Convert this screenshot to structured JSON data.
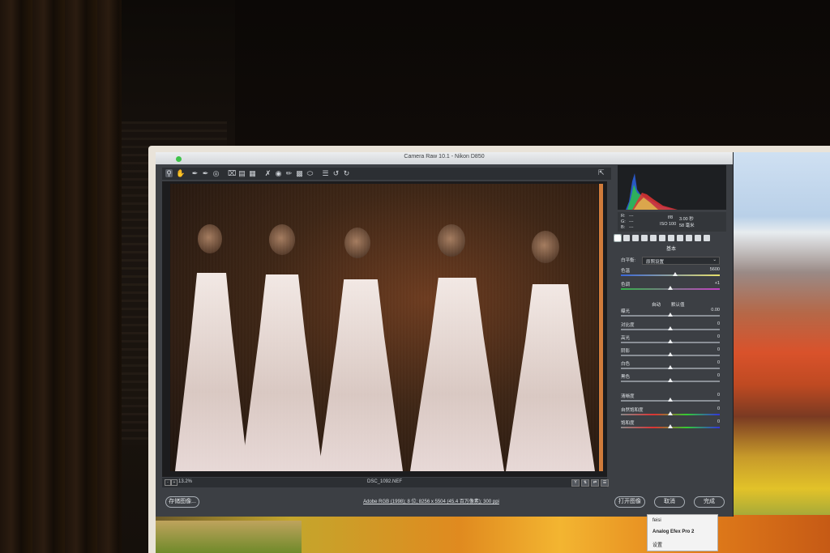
{
  "window": {
    "title": "Camera Raw 10.1 - Nikon D850"
  },
  "toolbar": {
    "tools": [
      "zoom-icon",
      "hand-icon",
      "white-balance-icon",
      "color-sampler-icon",
      "target-adjust-icon",
      "crop-icon",
      "straighten-icon",
      "transform-icon",
      "spot-removal-icon",
      "red-eye-icon",
      "adjustment-brush-icon",
      "graduated-filter-icon",
      "radial-filter-icon",
      "open-preferences-icon",
      "rotate-left-icon",
      "rotate-right-icon"
    ]
  },
  "status": {
    "zoom": "13.2%",
    "filename": "DSC_1092.NEF",
    "view_mode": "Y"
  },
  "footer": {
    "save_label": "存储图像...",
    "workflow_link": "Adobe RGB (1998); 8 位; 8256 x 5504 (45.4 百万像素); 300 ppi",
    "open_label": "打开图像",
    "cancel_label": "取消",
    "done_label": "完成"
  },
  "info": {
    "r": "R:",
    "g": "G:",
    "b": "B:",
    "r_val": "---",
    "g_val": "---",
    "b_val": "---",
    "aperture": "f/8",
    "shutter": "3.00 秒",
    "iso": "ISO 100",
    "focal": "58 毫米"
  },
  "panel": {
    "section_title": "基本",
    "wb_label": "白平衡:",
    "wb_value": "原照设置",
    "auto_label": "自动",
    "default_label": "默认值",
    "sliders": [
      {
        "label": "色温",
        "value": "5600",
        "pos": 0.55
      },
      {
        "label": "色调",
        "value": "+1",
        "pos": 0.5
      },
      {
        "label": "曝光",
        "value": "0.00",
        "pos": 0.5
      },
      {
        "label": "对比度",
        "value": "0",
        "pos": 0.5
      },
      {
        "label": "高光",
        "value": "0",
        "pos": 0.5
      },
      {
        "label": "阴影",
        "value": "0",
        "pos": 0.5
      },
      {
        "label": "白色",
        "value": "0",
        "pos": 0.5
      },
      {
        "label": "黑色",
        "value": "0",
        "pos": 0.5
      },
      {
        "label": "清晰度",
        "value": "0",
        "pos": 0.5
      },
      {
        "label": "自然饱和度",
        "value": "0",
        "pos": 0.5
      },
      {
        "label": "饱和度",
        "value": "0",
        "pos": 0.5
      }
    ]
  },
  "context_menu": {
    "item1": "feisi",
    "item2": "Analog Efex Pro 2",
    "item3": "设置"
  }
}
